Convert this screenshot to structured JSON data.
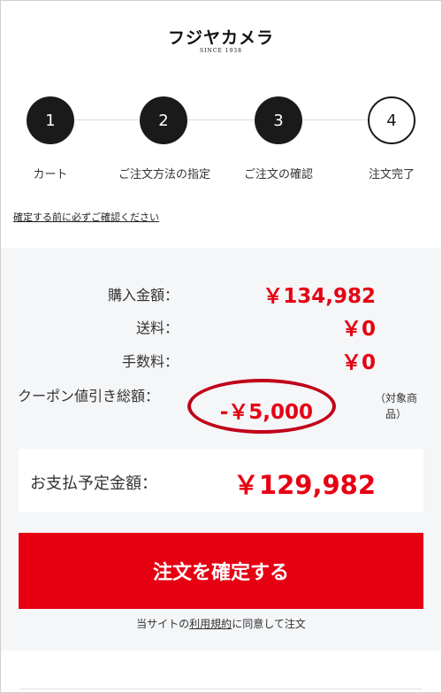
{
  "header": {
    "logo_text": "フジヤカメラ",
    "logo_subtext": "SINCE 1938"
  },
  "steps": [
    {
      "number": "1",
      "label": "カート",
      "state": "done"
    },
    {
      "number": "2",
      "label": "ご注文方法の指定",
      "state": "done"
    },
    {
      "number": "3",
      "label": "ご注文の確認",
      "state": "done"
    },
    {
      "number": "4",
      "label": "注文完了",
      "state": "todo"
    }
  ],
  "notice_link": "確定する前に必ずご確認ください",
  "summary": {
    "purchase_label": "購入金額：",
    "purchase_value": "￥134,982",
    "shipping_label": "送料：",
    "shipping_value": "￥0",
    "fee_label": "手数料：",
    "fee_value": "￥0",
    "coupon_label": "クーポン値引き総額：",
    "coupon_value": "-￥5,000",
    "coupon_note": "（対象商品）",
    "total_label": "お支払予定金額：",
    "total_value": "￥129,982"
  },
  "confirm_button": "注文を確定する",
  "agreement": {
    "prefix": "当サイトの",
    "link": "利用規約",
    "suffix": "に同意して注文"
  },
  "colors": {
    "accent": "#e60012",
    "step_done": "#1a1a1a",
    "summary_bg": "#f4f6f8",
    "annotation_ellipse": "#c00018"
  }
}
